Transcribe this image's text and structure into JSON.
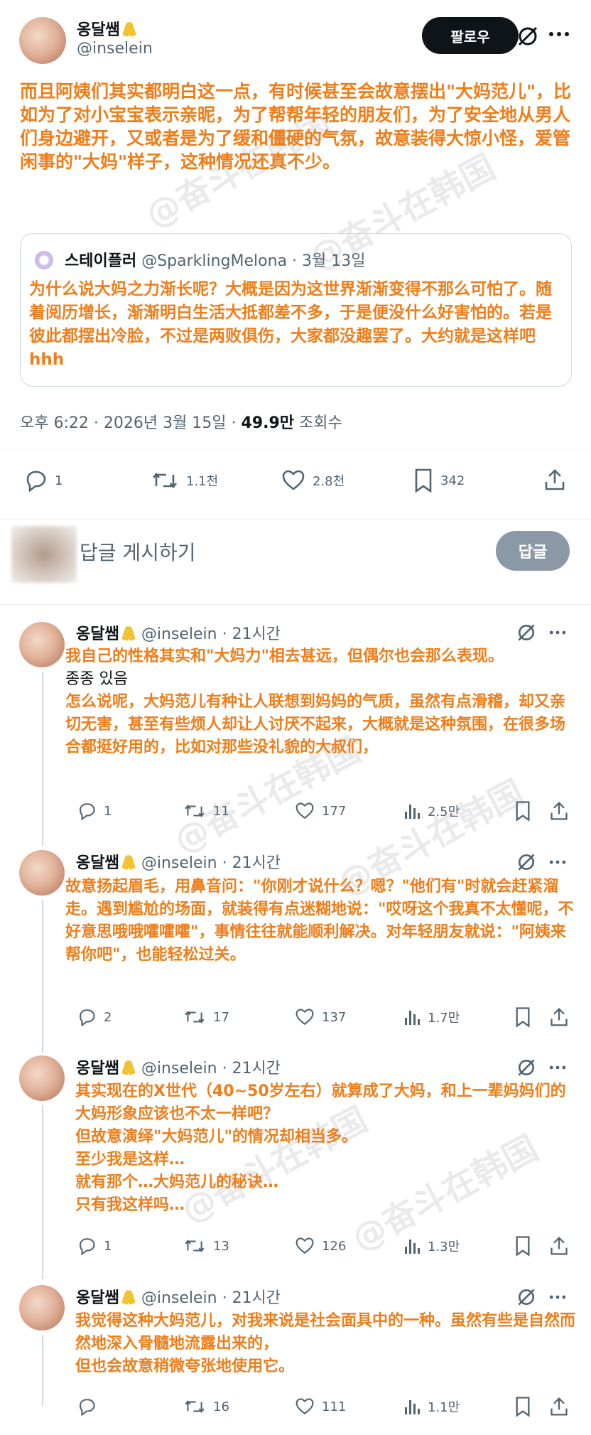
{
  "post": {
    "name": "옹달쌤",
    "handle": "@inselein",
    "follow_label": "팔로우",
    "text": "而且阿姨们其实都明白这一点，有时候甚至会故意摆出\"大妈范儿\"，比如为了对小宝宝表示亲昵，为了帮帮年轻的朋友们，为了安全地从男人们身边避开，又或者是为了缓和僵硬的气氛，故意装得大惊小怪，爱管闲事的\"大妈\"样子，这种情况还真不少。",
    "quote": {
      "name": "스테이플러",
      "handle": "@SparklingMelona",
      "date": "3월 13일",
      "text": "为什么说大妈之力渐长呢？大概是因为这世界渐渐变得不那么可怕了。随着阅历增长，渐渐明白生活大抵都差不多，于是便没什么好害怕的。若是彼此都摆出冷脸，不过是两败俱伤，大家都没趣罢了。大约就是这样吧hhh"
    },
    "meta_time": "오후 6:22 · 2026년 3월 15일 · ",
    "views_count": "49.9만",
    "views_label": " 조회수",
    "stats": {
      "replies": "1",
      "retweets": "1.1천",
      "likes": "2.8천",
      "bookmarks": "342"
    }
  },
  "reply_box": {
    "placeholder": "답글 게시하기",
    "button": "답글"
  },
  "replies": [
    {
      "name": "옹달쌤",
      "handle": "@inselein",
      "time": "21시간",
      "lines": [
        {
          "text": "我自己的性格其实和\"大妈力\"相去甚远，但偶尔也会那么表现。",
          "orange": true
        },
        {
          "text": "종종 있음",
          "orange": false
        },
        {
          "text": "怎么说呢，大妈范儿有种让人联想到妈妈的气质，虽然有点滑稽，却又亲切无害，甚至有些烦人却让人讨厌不起来，大概就是这种氛围，在很多场合都挺好用的，比如对那些没礼貌的大叔们，",
          "orange": true
        }
      ],
      "stats": {
        "replies": "1",
        "retweets": "11",
        "likes": "177",
        "views": "2.5만"
      }
    },
    {
      "name": "옹달쌤",
      "handle": "@inselein",
      "time": "21시간",
      "lines": [
        {
          "text": "故意扬起眉毛，用鼻音问：\"你刚才说什么？嗯？\"他们有\"时就会赶紧溜走。遇到尴尬的场面，就装得有点迷糊地说：\"哎呀这个我真不太懂呢，不好意思哦哦嚯嚯嚯\"，事情往往就能顺利解决。对年轻朋友就说：\"阿姨来帮你吧\"，也能轻松过关。",
          "orange": true
        }
      ],
      "stats": {
        "replies": "2",
        "retweets": "17",
        "likes": "137",
        "views": "1.7만"
      }
    },
    {
      "name": "옹달쌤",
      "handle": "@inselein",
      "time": "21시간",
      "lines": [
        {
          "text": "其实现在的X世代（40~50岁左右）就算成了大妈，和上一辈妈妈们的大妈形象应该也不太一样吧？",
          "orange": true
        },
        {
          "text": "但故意演绎\"大妈范儿\"的情况却相当多。",
          "orange": true
        },
        {
          "text": "至少我是这样…",
          "orange": true
        },
        {
          "text": "就有那个…大妈范儿的秘诀…",
          "orange": true
        },
        {
          "text": "只有我这样吗…",
          "orange": true
        }
      ],
      "stats": {
        "replies": "1",
        "retweets": "13",
        "likes": "126",
        "views": "1.3만"
      }
    },
    {
      "name": "옹달쌤",
      "handle": "@inselein",
      "time": "21시간",
      "lines": [
        {
          "text": "我觉得这种大妈范儿，对我来说是社会面具中的一种。虽然有些是自然而然地深入骨髓地流露出来的，",
          "orange": true
        },
        {
          "text": "但也会故意稍微夸张地使用它。",
          "orange": true
        }
      ],
      "stats": {
        "replies": "",
        "retweets": "16",
        "likes": "111",
        "views": "1.1만"
      }
    }
  ],
  "watermark": "@奋斗在韩国",
  "colors": {
    "accent_orange": "#ef7d1a",
    "ribbon": "#f1c232",
    "follow_bg": "#0f1419",
    "reply_btn_bg": "#8b98a5"
  },
  "icons": [
    "grok-icon",
    "more-icon",
    "reply-icon",
    "retweet-icon",
    "like-icon",
    "bookmark-icon",
    "share-icon",
    "views-icon",
    "ribbon-icon"
  ]
}
